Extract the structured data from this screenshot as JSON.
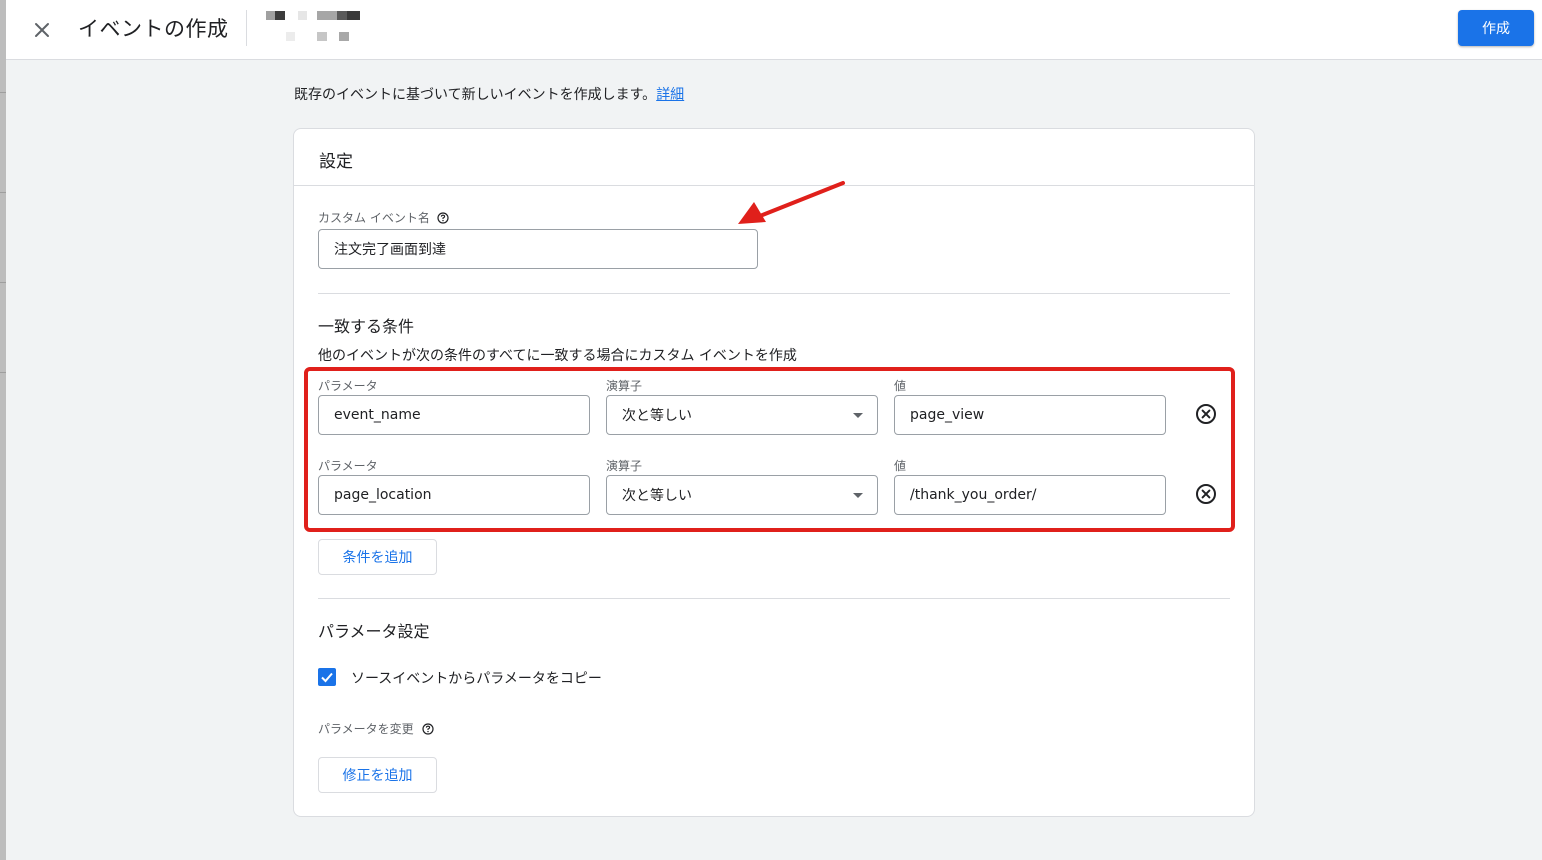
{
  "header": {
    "title": "イベントの作成",
    "create_label": "作成"
  },
  "intro": {
    "text": "既存のイベントに基づいて新しいイベントを作成します。",
    "link": "詳細"
  },
  "settings": {
    "title": "設定",
    "event_name_label": "カスタム イベント名",
    "event_name_value": "注文完了画面到達"
  },
  "conditions": {
    "title": "一致する条件",
    "description": "他のイベントが次の条件のすべてに一致する場合にカスタム イベントを作成",
    "param_label": "パラメータ",
    "operator_label": "演算子",
    "value_label": "値",
    "rows": [
      {
        "parameter": "event_name",
        "operator": "次と等しい",
        "value": "page_view"
      },
      {
        "parameter": "page_location",
        "operator": "次と等しい",
        "value": "/thank_you_order/"
      }
    ],
    "add_label": "条件を追加"
  },
  "param_settings": {
    "title": "パラメータ設定",
    "copy_label": "ソースイベントからパラメータをコピー",
    "copy_checked": true,
    "modify_label": "パラメータを変更",
    "add_modification_label": "修正を追加"
  },
  "colors": {
    "accent": "#1a73e8",
    "annotation": "#e0201b"
  }
}
